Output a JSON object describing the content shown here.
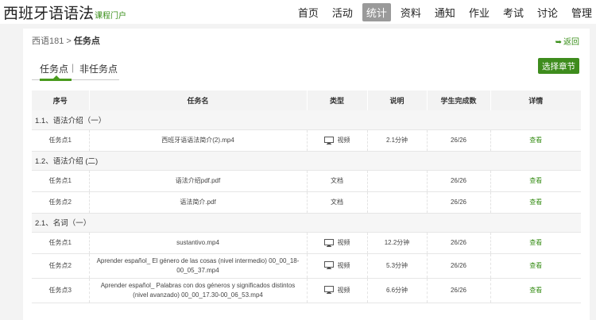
{
  "header": {
    "brand": "西班牙语语法",
    "brand_sub": "课程门户",
    "nav": [
      {
        "label": "首页",
        "active": false
      },
      {
        "label": "活动",
        "active": false
      },
      {
        "label": "统计",
        "active": true
      },
      {
        "label": "资料",
        "active": false
      },
      {
        "label": "通知",
        "active": false
      },
      {
        "label": "作业",
        "active": false
      },
      {
        "label": "考试",
        "active": false
      },
      {
        "label": "讨论",
        "active": false
      },
      {
        "label": "管理",
        "active": false
      }
    ]
  },
  "breadcrumb": {
    "parent": "西语181",
    "separator": ">",
    "current": "任务点"
  },
  "back_label": "返回",
  "tabs": {
    "tab1": "任务点",
    "separator": "|",
    "tab2": "非任务点"
  },
  "chapter_button": "选择章节",
  "table": {
    "headers": [
      "序号",
      "任务名",
      "类型",
      "说明",
      "学生完成数",
      "详情"
    ],
    "groups": [
      {
        "title": "1.1、语法介绍（一）",
        "rows": [
          {
            "seq": "任务点1",
            "name": "西班牙语语法简介(2).mp4",
            "type": "视频",
            "icon": "monitor-icon",
            "desc": "2.1分钟",
            "done": "26/26",
            "detail": "查看"
          }
        ]
      },
      {
        "title": "1.2、语法介绍 (二)",
        "rows": [
          {
            "seq": "任务点1",
            "name": "语法介绍pdf.pdf",
            "type": "文档",
            "icon": "",
            "desc": "",
            "done": "26/26",
            "detail": "查看"
          },
          {
            "seq": "任务点2",
            "name": "语法简介.pdf",
            "type": "文档",
            "icon": "",
            "desc": "",
            "done": "26/26",
            "detail": "查看"
          }
        ]
      },
      {
        "title": "2.1、名词（一）",
        "rows": [
          {
            "seq": "任务点1",
            "name": "sustantivo.mp4",
            "type": "视频",
            "icon": "monitor-icon",
            "desc": "12.2分钟",
            "done": "26/26",
            "detail": "查看"
          },
          {
            "seq": "任务点2",
            "name": "Aprender español_ El género de las cosas (nivel intermedio) 00_00_18-00_05_37.mp4",
            "type": "视频",
            "icon": "monitor-icon",
            "desc": "5.3分钟",
            "done": "26/26",
            "detail": "查看",
            "tall": true
          },
          {
            "seq": "任务点3",
            "name": "Aprender español_ Palabras con dos géneros y significados distintos (nivel avanzado) 00_00_17.30-00_06_53.mp4",
            "type": "视频",
            "icon": "monitor-icon",
            "desc": "6.6分钟",
            "done": "26/26",
            "detail": "查看",
            "tall": true
          }
        ]
      }
    ]
  }
}
